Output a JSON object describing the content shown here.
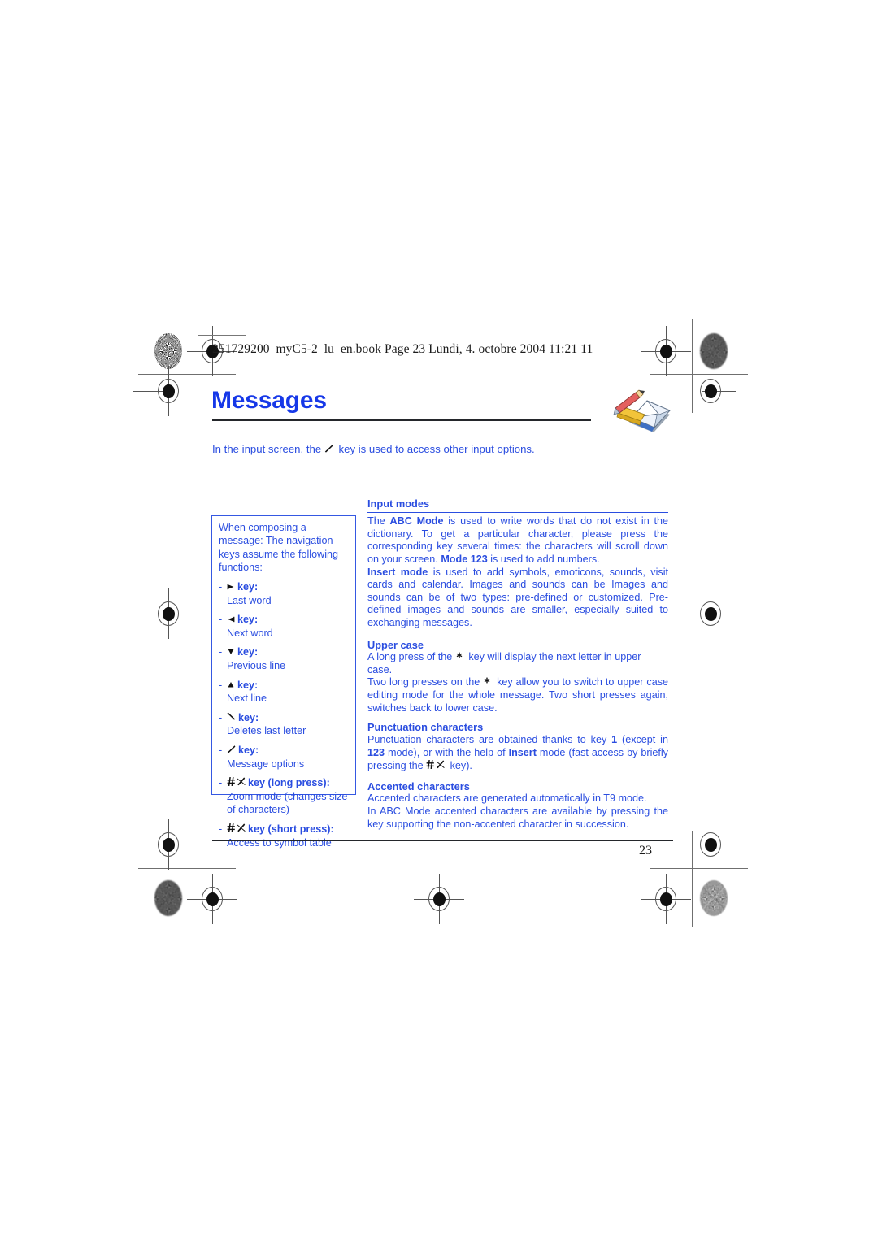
{
  "header": {
    "filename_line": "251729200_myC5-2_lu_en.book  Page 23  Lundi, 4. octobre 2004  11:21 11"
  },
  "title": "Messages",
  "title_icon": "envelope-pencil-icon",
  "intro": {
    "before": "In the input screen, the",
    "glyph": "pencil-key-icon",
    "after": "key is used to access other input options."
  },
  "left_box": {
    "lead": "When composing a message: The navigation keys assume the following functions:",
    "key_items": [
      {
        "glyph": "arrow-right-key-icon",
        "head": "key:",
        "desc": "Last word"
      },
      {
        "glyph": "arrow-left-key-icon",
        "head": "key:",
        "desc": "Next word"
      },
      {
        "glyph": "arrow-down-key-icon",
        "head": "key:",
        "desc": "Previous line"
      },
      {
        "glyph": "arrow-up-key-icon",
        "head": "key:",
        "desc": "Next line"
      },
      {
        "glyph": "backslash-key-icon",
        "head": "key:",
        "desc": "Deletes last letter"
      },
      {
        "glyph": "pencil-key-icon",
        "head": "key:",
        "desc": "Message options"
      },
      {
        "glyph": "hash-pencil-key-icon",
        "head": "key (long press):",
        "desc": "Zoom mode (changes size of characters)"
      },
      {
        "glyph": "hash-pencil-key-icon",
        "head": "key (short press):",
        "desc": "Access to symbol table"
      }
    ]
  },
  "right_col": {
    "sections": [
      {
        "heading": "Input modes",
        "has_rule": true,
        "paragraphs": [
          "The ABC Mode is used to write words that do not exist in the dictionary. To get a particular character, please press the corresponding key several times: the characters will scroll down on your screen. Mode 123 is used to add numbers.",
          "Insert mode is used to add symbols, emoticons, sounds, visit cards and calendar. Images and sounds can be Images and sounds can be of two types: pre-defined or customized. Pre-defined images and sounds are smaller, especially suited to exchanging messages."
        ]
      },
      {
        "heading": "Upper case",
        "has_rule": false,
        "paragraphs": [
          "A long press of the ✱ key will display the next letter in upper case.",
          "Two long presses on the ✱ key allow you to switch to upper case editing mode for the whole message. Two short presses again, switches back to lower case."
        ]
      },
      {
        "heading": "Punctuation characters",
        "has_rule": false,
        "paragraphs": [
          "Punctuation characters are obtained thanks to key 1 (except in 123 mode), or with the help of Insert mode (fast access by briefly pressing the # ✎ key)."
        ]
      },
      {
        "heading": "Accented characters",
        "has_rule": false,
        "paragraphs": [
          "Accented characters are generated automatically in T9 mode.",
          "In ABC Mode accented characters are available by pressing the key supporting the non-accented character in succession."
        ]
      }
    ]
  },
  "footer": {
    "page_number": "23"
  },
  "colors": {
    "blue_text": "#2a4de0",
    "title_blue": "#1638e8",
    "rule_dark": "#24272b"
  }
}
